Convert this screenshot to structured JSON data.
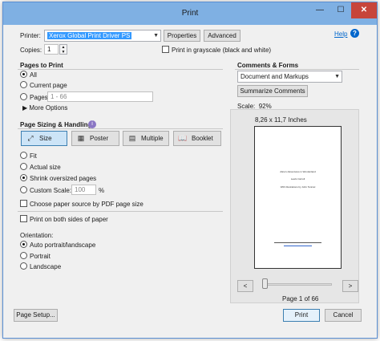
{
  "window": {
    "title": "Print",
    "minimize": "—",
    "maximize": "☐",
    "close": "✕"
  },
  "printer": {
    "label": "Printer:",
    "selected": "Xerox Global Print Driver PS",
    "properties_label": "Properties",
    "advanced_label": "Advanced",
    "help_label": "Help",
    "copies_label": "Copies:",
    "copies_value": "1",
    "grayscale_label": "Print in grayscale (black and white)",
    "grayscale_checked": false
  },
  "pages_to_print": {
    "heading": "Pages to Print",
    "options": [
      "All",
      "Current page",
      "Pages"
    ],
    "selected": "All",
    "pages_range": "1 - 66",
    "more_options_label": "More Options"
  },
  "sizing": {
    "heading": "Page Sizing & Handling",
    "buttons": [
      "Size",
      "Poster",
      "Multiple",
      "Booklet"
    ],
    "active_button": "Size",
    "options": [
      "Fit",
      "Actual size",
      "Shrink oversized pages",
      "Custom Scale:"
    ],
    "selected": "Shrink oversized pages",
    "custom_scale_value": "100",
    "custom_scale_unit": "%",
    "paper_source_label": "Choose paper source by PDF page size",
    "both_sides_label": "Print on both sides of paper"
  },
  "orientation": {
    "heading": "Orientation:",
    "options": [
      "Auto portrait/landscape",
      "Portrait",
      "Landscape"
    ],
    "selected": "Auto portrait/landscape"
  },
  "comments": {
    "heading": "Comments & Forms",
    "selected": "Document and Markups",
    "summarize_label": "Summarize Comments"
  },
  "preview": {
    "scale_label": "Scale:",
    "scale_value": "92%",
    "page_size": "8,26 x 11,7 Inches",
    "page_indicator": "Page 1 of 66",
    "prev": "<",
    "next": ">",
    "page_title": "Alice's Adventures in Wonderland",
    "page_author": "Lewis Carroll",
    "page_illustrations": "With illustrations by John Tenniel"
  },
  "footer": {
    "page_setup_label": "Page Setup...",
    "print_label": "Print",
    "cancel_label": "Cancel"
  },
  "colors": {
    "title_bar": "#7fb0e3",
    "close_button": "#c7453a",
    "selected_printer_bg": "#3399ff",
    "help_link": "#0066cc"
  }
}
